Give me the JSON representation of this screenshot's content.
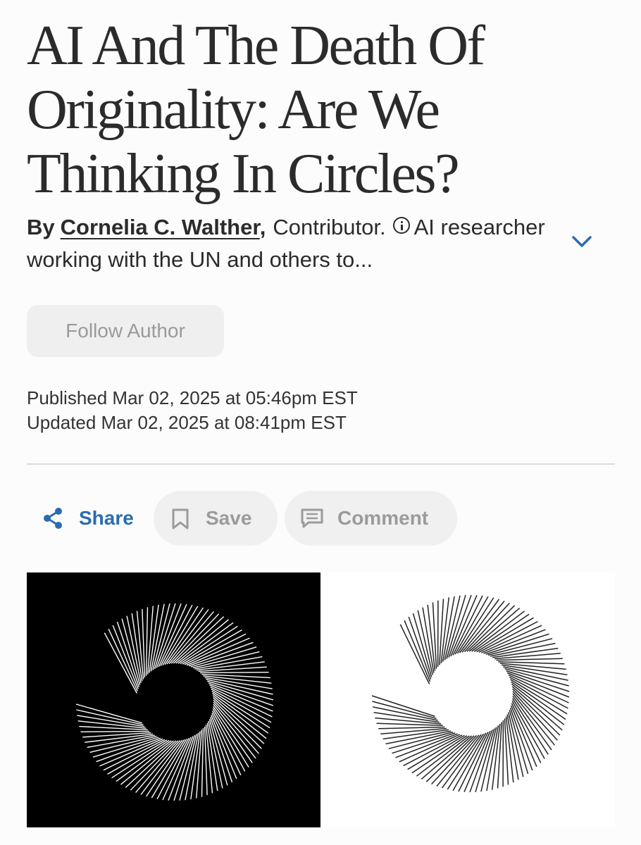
{
  "article": {
    "headline": "AI And The Death Of Originality: Are We Thinking In Circles?",
    "byline": {
      "by_label": "By",
      "author_name": "Cornelia C. Walther",
      "comma": ",",
      "role": "Contributor.",
      "bio": "AI researcher working with the UN and others to..."
    },
    "follow_label": "Follow Author",
    "published": "Published Mar 02, 2025 at 05:46pm EST",
    "updated": "Updated Mar 02, 2025 at 08:41pm EST"
  },
  "actions": {
    "share_label": "Share",
    "save_label": "Save",
    "comment_label": "Comment"
  },
  "icons": {
    "info": "info-icon",
    "expand": "chevron-down-icon",
    "share": "share-icon",
    "save": "bookmark-icon",
    "comment": "comment-icon"
  },
  "colors": {
    "accent": "#2b6cb0",
    "text": "#2b2b2b",
    "muted": "#9b9b9b",
    "button_bg": "#f0f0f0",
    "hero_dark": "#000000",
    "hero_light": "#ffffff"
  }
}
